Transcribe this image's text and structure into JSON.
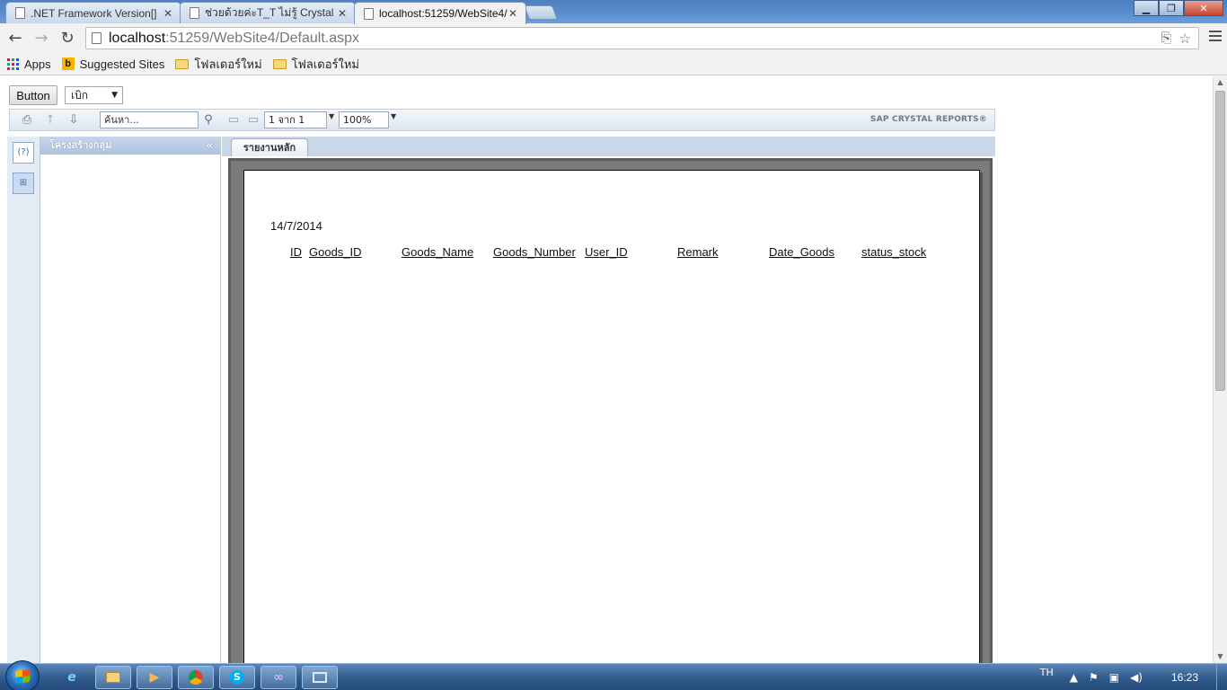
{
  "browser": {
    "tabs": [
      {
        "title": ".NET Framework Version[]"
      },
      {
        "title": "ช่วยด้วยค่ะT_T ไม่รู้ Crystal"
      },
      {
        "title": "localhost:51259/WebSite4/"
      }
    ],
    "close_glyph": "✕",
    "url_host": "localhost",
    "url_path": ":51259/WebSite4/Default.aspx",
    "bookmarks": [
      {
        "label": "Apps",
        "icon": "apps-icon"
      },
      {
        "label": "Suggested Sites",
        "icon": "bing-icon"
      },
      {
        "label": "โฟลเดอร์ใหม่",
        "icon": "folder-icon"
      },
      {
        "label": "โฟลเดอร์ใหม่",
        "icon": "folder-icon"
      }
    ]
  },
  "page": {
    "button_label": "Button",
    "dropdown_value": "เบิก"
  },
  "crystal": {
    "search_placeholder": "ค้นหา...",
    "page_indicator": "1 จาก 1",
    "zoom": "100%",
    "brand": "SAP CRYSTAL REPORTS®",
    "group_tree_title": "โครงสร้างกลุ่ม",
    "main_tab": "รายงานหลัก",
    "help_glyph": "(?)"
  },
  "report": {
    "date": "14/7/2014",
    "columns": [
      "ID",
      "Goods_ID",
      "Goods_Name",
      "Goods_Number",
      "User_ID",
      "Remark",
      "Date_Goods",
      "status_stock"
    ]
  },
  "taskbar": {
    "language": "TH",
    "clock": "16:23"
  }
}
